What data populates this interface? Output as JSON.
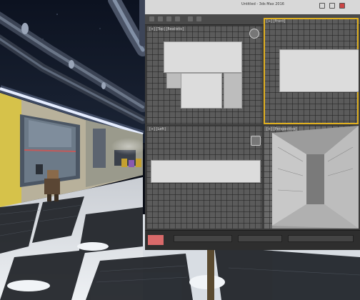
{
  "scene": {
    "description_free": true,
    "colors": {
      "night_sky": "#0b0f18",
      "corridor_wall": "#cfc7b0",
      "door_panel": "#6c7a88",
      "door_trim_red": "#c25a5a",
      "snow": "#e8ecf0",
      "metal_grate": "#1a1d22",
      "hazard_yellow": "#d6c24a",
      "light_strip": "#f4f7ff",
      "monitor_frame": "#3a3a3a"
    }
  },
  "monitor": {
    "titlebar": {
      "title": "Untitled - 3ds Max 2016"
    },
    "viewports": [
      {
        "id": "top",
        "label": "[+] [Top] [Realistic]",
        "active": false
      },
      {
        "id": "front",
        "label": "[+] [Front]",
        "active": true
      },
      {
        "id": "left",
        "label": "[+] [Left]",
        "active": false
      },
      {
        "id": "perspective",
        "label": "[+] [Perspective]",
        "active": false
      }
    ]
  }
}
